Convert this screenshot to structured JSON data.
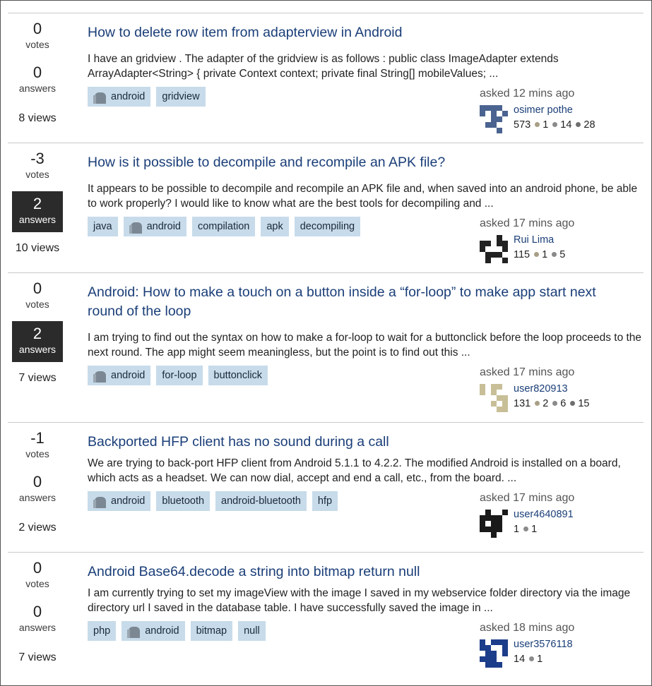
{
  "questions": [
    {
      "votes": "0",
      "votes_label": "votes",
      "answers": "0",
      "answers_label": "answers",
      "answered": false,
      "views": "8 views",
      "title": "How to delete row item from adapterview in Android",
      "excerpt": "I have an gridview . The adapter of the gridview is as follows : public class ImageAdapter extends ArrayAdapter<String> { private Context context; private final String[] mobileValues; ...",
      "tags": [
        {
          "label": "android",
          "icon": "android-icon"
        },
        {
          "label": "gridview"
        }
      ],
      "asked": "asked 12 mins ago",
      "user": "osimer pothe",
      "rep": "573",
      "badges": [
        {
          "count": "1",
          "type": "silver"
        },
        {
          "count": "14",
          "type": "bronze"
        },
        {
          "count": "28",
          "type": "bronze2"
        }
      ],
      "avatar_color": "#4a6390"
    },
    {
      "votes": "-3",
      "votes_label": "votes",
      "answers": "2",
      "answers_label": "answers",
      "answered": true,
      "views": "10 views",
      "title": "How is it possible to decompile and recompile an APK file?",
      "excerpt": "It appears to be possible to decompile and recompile an APK file and, when saved into an android phone, be able to work properly? I would like to know what are the best tools for decompiling and ...",
      "tags": [
        {
          "label": "java"
        },
        {
          "label": "android",
          "icon": "android-icon"
        },
        {
          "label": "compilation"
        },
        {
          "label": "apk"
        },
        {
          "label": "decompiling"
        }
      ],
      "asked": "asked 17 mins ago",
      "user": "Rui Lima",
      "rep": "115",
      "badges": [
        {
          "count": "1",
          "type": "silver"
        },
        {
          "count": "5",
          "type": "bronze"
        }
      ],
      "avatar_color": "#222222"
    },
    {
      "votes": "0",
      "votes_label": "votes",
      "answers": "2",
      "answers_label": "answers",
      "answered": true,
      "views": "7 views",
      "title": "Android: How to make a touch on a button inside a “for-loop” to make app start next round of the loop",
      "excerpt": "I am trying to find out the syntax on how to make a for-loop to wait for a buttonclick before the loop proceeds to the next round. The app might seem meaningless, but the point is to find out this ...",
      "tags": [
        {
          "label": "android",
          "icon": "android-icon"
        },
        {
          "label": "for-loop"
        },
        {
          "label": "buttonclick"
        }
      ],
      "asked": "asked 17 mins ago",
      "user": "user820913",
      "rep": "131",
      "badges": [
        {
          "count": "2",
          "type": "silver"
        },
        {
          "count": "6",
          "type": "bronze"
        },
        {
          "count": "15",
          "type": "bronze2"
        }
      ],
      "avatar_color": "#c8bf98"
    },
    {
      "votes": "-1",
      "votes_label": "votes",
      "answers": "0",
      "answers_label": "answers",
      "answered": false,
      "views": "2 views",
      "title": "Backported HFP client has no sound during a call",
      "excerpt": "We are trying to back-port HFP client from Android 5.1.1 to 4.2.2. The modified Android is installed on a board, which acts as a headset. We can now dial, accept and end a call, etc., from the board. ...",
      "tags": [
        {
          "label": "android",
          "icon": "android-icon"
        },
        {
          "label": "bluetooth"
        },
        {
          "label": "android-bluetooth"
        },
        {
          "label": "hfp"
        }
      ],
      "asked": "asked 17 mins ago",
      "user": "user4640891",
      "rep": "1",
      "badges": [
        {
          "count": "1",
          "type": "bronze"
        }
      ],
      "avatar_color": "#1a1a1a"
    },
    {
      "votes": "0",
      "votes_label": "votes",
      "answers": "0",
      "answers_label": "answers",
      "answered": false,
      "views": "7 views",
      "title": "Android Base64.decode a string into bitmap return null",
      "excerpt": "I am currently trying to set my imageView with the image I saved in my webservice folder directory via the image directory url I saved in the database table. I have successfully saved the image in ...",
      "tags": [
        {
          "label": "php"
        },
        {
          "label": "android",
          "icon": "android-icon"
        },
        {
          "label": "bitmap"
        },
        {
          "label": "null"
        }
      ],
      "asked": "asked 18 mins ago",
      "user": "user3576118",
      "rep": "14",
      "badges": [
        {
          "count": "1",
          "type": "bronze"
        }
      ],
      "avatar_color": "#1c3d8a"
    }
  ]
}
